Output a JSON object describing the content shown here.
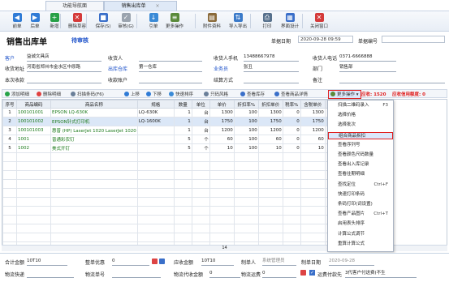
{
  "tabs": {
    "home": "功能导航面",
    "active": "销售出库单"
  },
  "toolbar": [
    {
      "label": "前单",
      "icon": "◀",
      "color": "#2f7bd6"
    },
    {
      "label": "后单",
      "icon": "▶",
      "color": "#2f7bd6"
    },
    {
      "label": "新增",
      "icon": "+",
      "color": "#26a046"
    },
    {
      "label": "删除草容",
      "icon": "✕",
      "color": "#d43a3a"
    },
    {
      "label": "保存(S)",
      "icon": "■",
      "color": "#3a6fc9"
    },
    {
      "label": "审核(G)",
      "icon": "✓",
      "color": "#9aa3ae"
    },
    {
      "label": "引单",
      "icon": "↓",
      "color": "#3a8ad6"
    },
    {
      "label": "更多操作",
      "icon": "≡",
      "color": "#5a8a3a"
    },
    {
      "label": "附件资料",
      "icon": "▤",
      "color": "#8a6a3a"
    },
    {
      "label": "导入导出",
      "icon": "⇅",
      "color": "#3a7ac9"
    },
    {
      "label": "打印",
      "icon": "⎙",
      "color": "#56708c"
    },
    {
      "label": "界面设计",
      "icon": "▦",
      "color": "#3a6fc9"
    },
    {
      "label": "关闭窗口",
      "icon": "✕",
      "color": "#d43a3a"
    }
  ],
  "header": {
    "title": "销售出库单",
    "status": "待审核",
    "date_label": "单据日期",
    "date_value": "2020-09-28 09:59",
    "no_label": "单据编号"
  },
  "form": {
    "customer_label": "客户",
    "customer_value": "益诚文具店",
    "receiver_label": "收货人",
    "receiver_phone_label": "收货人手机",
    "receiver_phone_value": "13488667978",
    "receiver_tel_label": "收货人电话",
    "receiver_tel_value": "0371-6666888",
    "address_label": "收货地址",
    "address_value": "河南省郑州市金水区中原路",
    "warehouse_label": "出库仓库",
    "warehouse_value": "第一仓库",
    "salesman_label": "业务员",
    "salesman_value": "张丑",
    "dept_label": "部门",
    "dept_value": "销售部",
    "order_label": "本次收款",
    "account_label": "收款账户",
    "settle_label": "结算方式",
    "remark_label": "备注"
  },
  "grid_toolbar": {
    "add": "添加明细",
    "delete": "删除明细",
    "scan": "扫描条码(F6)",
    "up": "上移",
    "down": "下移",
    "sort": "快速排序",
    "print": "只码风格",
    "stock": "查看库存",
    "detail": "查看商品详情",
    "more": "更多操作",
    "profit_label": "应收:",
    "profit_value": "1520",
    "credit_label": "应收信用额度:",
    "credit_value": "0"
  },
  "grid": {
    "columns": [
      "序号",
      "商品编码",
      "商品名称",
      "规格",
      "数量",
      "单位",
      "单价",
      "折扣率%",
      "折扣单价",
      "税率%",
      "含税单价",
      "含"
    ],
    "rows": [
      [
        "1",
        "100101001",
        "EPSON LQ-630K",
        "LQ-630K",
        "1",
        "台",
        "1300",
        "100",
        "1300",
        "0",
        "1300",
        "0"
      ],
      [
        "2",
        "100101002",
        "EPSON针式打印机",
        "LQ-1600K",
        "1",
        "台",
        "1750",
        "100",
        "1750",
        "0",
        "1750",
        "0"
      ],
      [
        "3",
        "100101003",
        "惠普 (HP) LaserJet 1020 LaserJet 1020",
        "",
        "1",
        "台",
        "1200",
        "100",
        "1200",
        "0",
        "1200",
        "0"
      ],
      [
        "4",
        "1001",
        "普通彩农钉",
        "",
        "5",
        "个",
        "60",
        "100",
        "60",
        "0",
        "60",
        "0"
      ],
      [
        "5",
        "1002",
        "美式开钉",
        "",
        "5",
        "个",
        "10",
        "100",
        "10",
        "0",
        "10",
        "0"
      ]
    ],
    "footer_total": "14"
  },
  "menu": [
    {
      "label": "扫描二维码录入",
      "shortcut": "F3"
    },
    {
      "label": "选择价格",
      "shortcut": ""
    },
    {
      "label": "选择批次",
      "shortcut": ""
    },
    {
      "label": "组合商品拆扣",
      "shortcut": ""
    },
    {
      "label": "查看序列号",
      "shortcut": ""
    },
    {
      "label": "查看颜色尺码数量",
      "shortcut": ""
    },
    {
      "label": "查看出入库记录",
      "shortcut": ""
    },
    {
      "label": "查看往期明细",
      "shortcut": ""
    },
    {
      "label": "查找定位",
      "shortcut": "Ctrl+F"
    },
    {
      "label": "快速打印条码",
      "shortcut": ""
    },
    {
      "label": "条码打印(词设置)",
      "shortcut": ""
    },
    {
      "label": "查看产品图片",
      "shortcut": "Ctrl+T"
    },
    {
      "label": "启用表头排序",
      "shortcut": ""
    },
    {
      "label": "计算公式调节",
      "shortcut": ""
    },
    {
      "label": "重算计算公式",
      "shortcut": ""
    }
  ],
  "menu_highlight_index": 3,
  "footer": {
    "total_label": "合计金额",
    "total_value": "10T10",
    "discount_label": "整单优惠",
    "discount_value": "0",
    "receivable_label": "应收金额",
    "receivable_value": "10T10",
    "maker_label": "制单人",
    "maker_value": "系统管理员",
    "make_date_label": "制单日期",
    "make_date_value": "2020-09-28",
    "express_label": "物流快递",
    "express_no_label": "物流单号",
    "freight_label": "物流代收金额",
    "freight_value": "0",
    "ship_fee_label": "物流运费",
    "ship_fee_value": "0",
    "ship_option": "运费付款先",
    "ship_option_value": "3代客户付送费(不生"
  }
}
